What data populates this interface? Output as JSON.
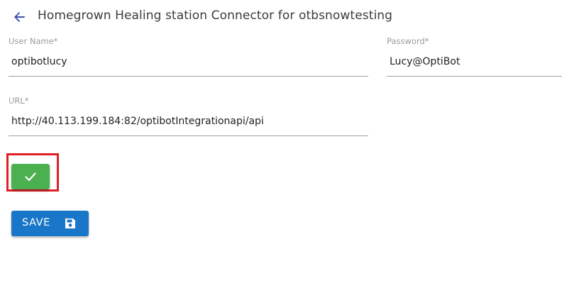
{
  "header": {
    "title": "Homegrown Healing station Connector for otbsnowtesting",
    "back_icon": "arrow-left-icon"
  },
  "form": {
    "username": {
      "label": "User Name*",
      "value": "optibotlucy"
    },
    "password": {
      "label": "Password*",
      "value": "Lucy@OptiBot"
    },
    "url": {
      "label": "URL*",
      "value": "http://40.113.199.184:82/optibotIntegrationapi/api"
    }
  },
  "actions": {
    "check_icon": "checkmark-icon",
    "save_label": "SAVE",
    "save_icon": "floppy-disk-icon"
  },
  "colors": {
    "back_arrow": "#3f51b5",
    "check_button": "#4caf50",
    "save_button": "#1976c8",
    "highlight": "#e01e26",
    "underline": "#9e9e9e",
    "label": "#9a9a9a"
  }
}
